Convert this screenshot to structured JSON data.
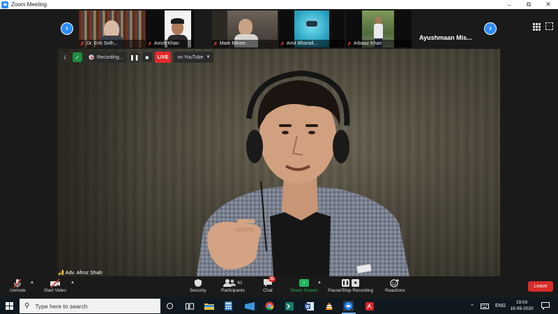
{
  "window": {
    "title": "Zoom Meeting"
  },
  "participants": [
    {
      "name": "Dr. Erik Solh..."
    },
    {
      "name": "Anish Khan"
    },
    {
      "name": "Mark Minne..."
    },
    {
      "name": "Amit Bharad..."
    },
    {
      "name": "Arbaaz Khan"
    }
  ],
  "overflow_participant": {
    "name": "Ayushmaan Mis..."
  },
  "recording": {
    "status": "Recording...",
    "live_label": "LIVE",
    "destination": "on YouTube"
  },
  "active_speaker": {
    "name": "Adv. Afroz Shah"
  },
  "controls": {
    "unmute": "Unmute",
    "start_video": "Start Video",
    "security": "Security",
    "participants": "Participants",
    "participant_count": "61",
    "chat": "Chat",
    "chat_unread": "31",
    "share_screen": "Share Screen",
    "pause_stop_recording": "Pause/Stop Recording",
    "reactions": "Reactions",
    "leave": "Leave"
  },
  "taskbar": {
    "search_placeholder": "Type here to search",
    "language": "ENG",
    "time": "19:03",
    "date": "19-09-2020"
  },
  "colors": {
    "zoom_blue": "#2d8cff",
    "live_red": "#e22b2b",
    "share_green": "#23b35a",
    "leave_red": "#d92b2b"
  }
}
